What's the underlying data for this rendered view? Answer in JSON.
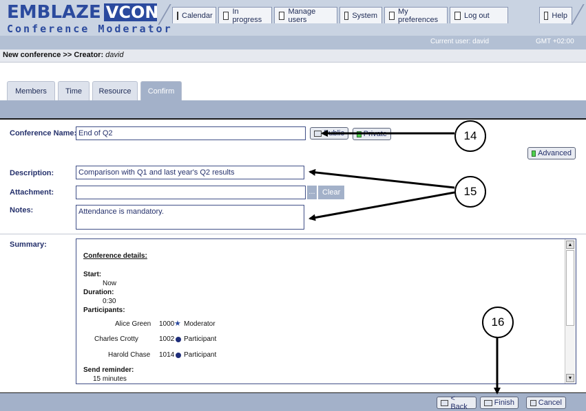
{
  "header": {
    "logo_word": "EMBLAZE",
    "logo_mark": "VCON",
    "app_title": "Conference Moderator",
    "current_user": "Current user: david",
    "timezone": "GMT +02:00"
  },
  "nav": {
    "items": [
      {
        "label": "Calendar",
        "icon": "calendar-tab-icon",
        "active": true
      },
      {
        "label": "In progress",
        "icon": "in-progress-tab-icon"
      },
      {
        "label": "Manage users",
        "icon": "users-tab-icon"
      },
      {
        "label": "System",
        "icon": "system-tab-icon"
      },
      {
        "label": "My preferences",
        "icon": "preferences-tab-icon"
      },
      {
        "label": "Log out",
        "icon": "logout-tab-icon"
      },
      {
        "label": "Help",
        "icon": "help-tab-icon"
      }
    ]
  },
  "breadcrumb": {
    "path": "New conference >> Creator: ",
    "creator": "david"
  },
  "tabs": [
    {
      "label": "Members"
    },
    {
      "label": "Time"
    },
    {
      "label": "Resource"
    },
    {
      "label": "Confirm",
      "active": true
    }
  ],
  "form": {
    "conference_name_label": "Conference Name:",
    "conference_name_value": "End of Q2",
    "public_button": "Public",
    "private_button": "Private",
    "advanced_button": "Advanced",
    "description_label": "Description:",
    "description_value": "Comparison with Q1 and last year's Q2 results",
    "attachment_label": "Attachment:",
    "attachment_value": "",
    "browse_button": "...",
    "clear_button": "Clear",
    "notes_label": "Notes:",
    "notes_value": "Attendance is mandatory.",
    "summary_label": "Summary:"
  },
  "summary": {
    "heading": "Conference details:",
    "start_label": "Start:",
    "start_value": "Now",
    "duration_label": "Duration:",
    "duration_value": "0:30",
    "participants_label": "Participants:",
    "participants": [
      {
        "name": "Alice Green",
        "number": "1000",
        "role": "Moderator",
        "icon": "moderator-icon"
      },
      {
        "name": "Charles Crotty",
        "number": "1002",
        "role": "Participant",
        "icon": "participant-icon"
      },
      {
        "name": "Harold Chase",
        "number": "1014",
        "role": "Participant",
        "icon": "participant-icon"
      }
    ],
    "reminder_label": "Send reminder:",
    "reminder_value": "15 minutes"
  },
  "footer": {
    "back_button": "< Back",
    "finish_button": "Finish",
    "cancel_button": "Cancel"
  },
  "callouts": [
    "14",
    "15",
    "16"
  ],
  "colors": {
    "brand_blue": "#2b4a9e",
    "header_bg": "#c9d3e2",
    "bar_bg": "#a3b1c9",
    "active_indicator": "#3bd13b"
  }
}
